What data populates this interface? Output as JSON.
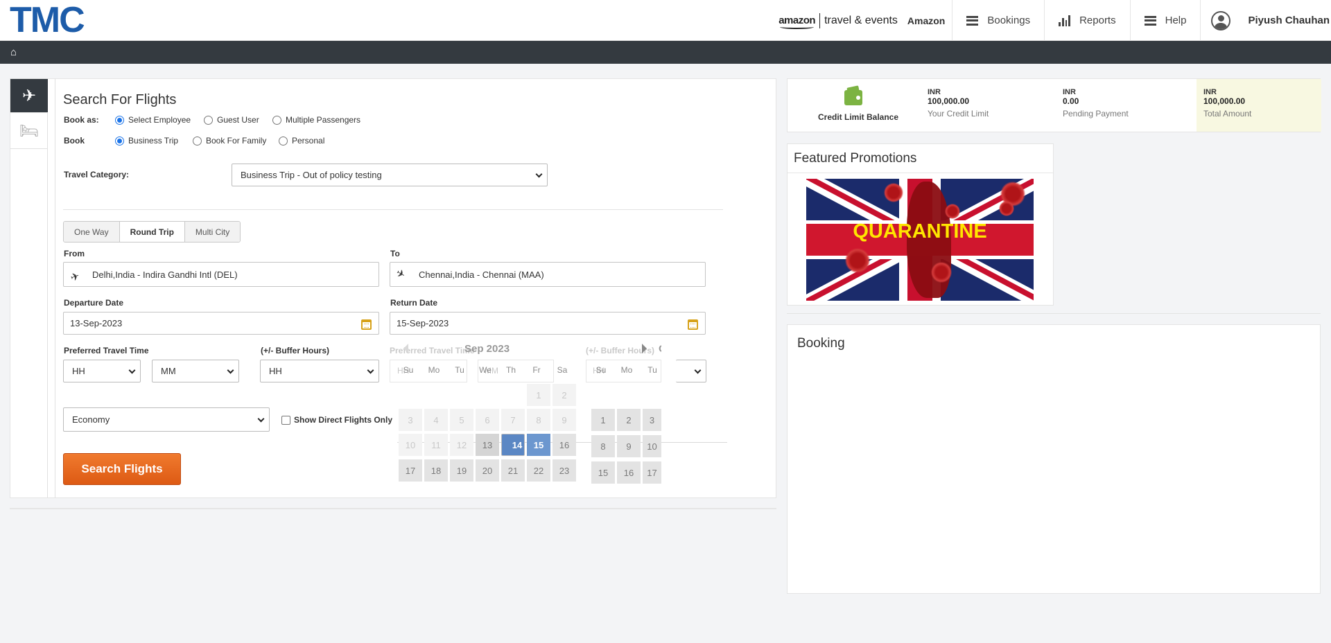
{
  "header": {
    "logo": "TMC",
    "brand_amazon": "amazon",
    "brand_te": "travel & events",
    "brand_name": "Amazon",
    "nav": [
      {
        "label": "Bookings",
        "icon": "menu-icon"
      },
      {
        "label": "Reports",
        "icon": "bar-chart-icon"
      },
      {
        "label": "Help",
        "icon": "menu-icon"
      }
    ],
    "user_name": "Piyush Chauhan"
  },
  "homebar": {
    "icon": "home-icon"
  },
  "search": {
    "title": "Search For Flights",
    "book_as_label": "Book as:",
    "book_as_options": [
      "Select Employee",
      "Guest User",
      "Multiple Passengers"
    ],
    "book_as_selected": "Select Employee",
    "book_label": "Book",
    "book_options": [
      "Business Trip",
      "Book For Family",
      "Personal"
    ],
    "book_selected": "Business Trip",
    "travel_category_label": "Travel Category:",
    "travel_category_value": "Business Trip - Out of policy testing",
    "trip_types": [
      "One Way",
      "Round Trip",
      "Multi City"
    ],
    "trip_type_selected": "Round Trip",
    "from_label": "From",
    "from_value": "Delhi,India - Indira Gandhi Intl (DEL)",
    "to_label": "To",
    "to_value": "Chennai,India - Chennai (MAA)",
    "departure_label": "Departure Date",
    "departure_value": "13-Sep-2023",
    "return_label": "Return Date",
    "return_value": "15-Sep-2023",
    "pref_time_label": "Preferred Travel Time",
    "hh": "HH",
    "mm": "MM",
    "buffer_label": "(+/- Buffer Hours)",
    "buffer_value": "HH",
    "cabin_value": "Economy",
    "direct_only_label": "Show Direct Flights Only",
    "search_button": "Search Flights"
  },
  "datepicker": {
    "month": "Sep 2023",
    "next_month_initial": "O",
    "ghost_pref": "Preferred Travel Time",
    "ghost_buffer": "(+/- Buffer Hours)",
    "ghost_hh": "HH",
    "ghost_mm": "MM",
    "dow": [
      "Su",
      "Mo",
      "Tu",
      "We",
      "Th",
      "Fr",
      "Sa"
    ],
    "dow2": [
      "Su",
      "Mo",
      "Tu"
    ],
    "row1": [
      "1",
      "2"
    ],
    "row2": [
      "3",
      "4",
      "5",
      "6",
      "7",
      "8",
      "9"
    ],
    "row3": [
      "10",
      "11",
      "12",
      "13",
      "14",
      "15",
      "16"
    ],
    "row4": [
      "17",
      "18",
      "19",
      "20",
      "21",
      "22",
      "23"
    ],
    "next_row1": [
      "1",
      "2",
      "3"
    ],
    "next_row2": [
      "8",
      "9",
      "10"
    ],
    "next_row3": [
      "15",
      "16",
      "17"
    ],
    "selected_start": "14",
    "selected_end": "15"
  },
  "credit": {
    "label": "Credit Limit Balance",
    "items": [
      {
        "currency": "INR",
        "value": "100,000.00",
        "desc": "Your Credit Limit"
      },
      {
        "currency": "INR",
        "value": "0.00",
        "desc": "Pending Payment"
      },
      {
        "currency": "INR",
        "value": "100,000.00",
        "desc": "Total Amount"
      }
    ]
  },
  "promotions": {
    "title": "Featured Promotions",
    "image_text": "QUARANTINE"
  },
  "booking": {
    "title": "Booking"
  },
  "colors": {
    "brand_blue": "#1d5ca9",
    "dark_bar": "#343a40",
    "orange_button": "#e8661f",
    "selected_day": "#5b87c4",
    "wallet_green": "#7cb342",
    "total_bg": "#f8f8e1"
  }
}
